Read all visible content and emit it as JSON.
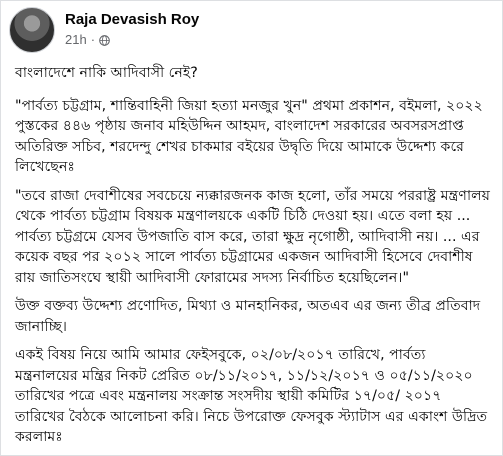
{
  "post": {
    "author": "Raja Devasish Roy",
    "timestamp": "21h",
    "separator": "·",
    "audience_icon": "globe-icon",
    "paragraphs": [
      "বাংলাদেশে নাকি আদিবাসী নেই?",
      "\"পার্বত্য চট্টগ্রাম, শান্তিবাহিনী জিয়া হত্যা মনজুর খুন\" প্রথমা প্রকাশন, বইমলা, ২০২২ পুস্তকের ৪৪৬ পৃষ্ঠায় জনাব মহিউদ্দিন আহমদ, বাংলাদেশ সরকারের অবসরসপ্রাপ্ত অতিরিক্ত সচিব, শরদেন্দু শেখর চাকমার বইয়ের উদ্বৃতি দিয়ে আমাকে উদ্দেশ্য করে লিখেছেনঃ",
      "\"তবে রাজা দেবাশীষের সবচেয়ে ন্যক্কারজনক কাজ হলো, তাঁর সময়ে পররাষ্ট্র মন্ত্রণালয় থেকে পার্বত্য চট্টগ্রাম বিষয়ক মন্ত্রণালয়কে একটি চিঠি দেওয়া হয়। এতে বলা হয় ... পার্বত্য চট্টগ্রমে যেসব উপজাতি বাস করে, তারা ক্ষুদ্র নৃগোষ্ঠী, আদিবাসী নয়। ... এর কয়েক বছর পর ২০১২ সালে পার্বত্য চট্টগ্রামের একজন আদিবাসী হিসেবে দেবাশীষ রায় জাতিসংঘে স্থায়ী আদিবাসী ফোরামের সদস্য নির্বাচিত হয়েছিলেন।\"",
      "উক্ত বক্তব্য উদ্দেশ্য প্রণোদিত, মিথ্যা ও মানহানিকর, অতএব এর জন্য তীব্র প্রতিবাদ জানাচ্ছি।",
      "একই বিষয় নিয়ে আমি আমার ফেইসবুকে, ০২/০৮/২০১৭ তারিখে, পার্বত্য মন্ত্রনালয়ের মন্ত্রির নিকট প্রেরিত ০৮/১১/২০১৭, ১১/১২/২০১৭ ও ০৫/১১/২০২০ তারিখের পত্রে এবং মন্ত্রনালয় সংক্রান্ত সংসদীয় স্থায়ী কমিটির ১৭/০৫/ ২০১৭ তারিখের বৈঠকে আলোচনা করি। নিচে উপরোক্ত ফেসবুক স্ট্যাটাস এর একাংশ উদ্রিত করলামঃ"
    ]
  }
}
